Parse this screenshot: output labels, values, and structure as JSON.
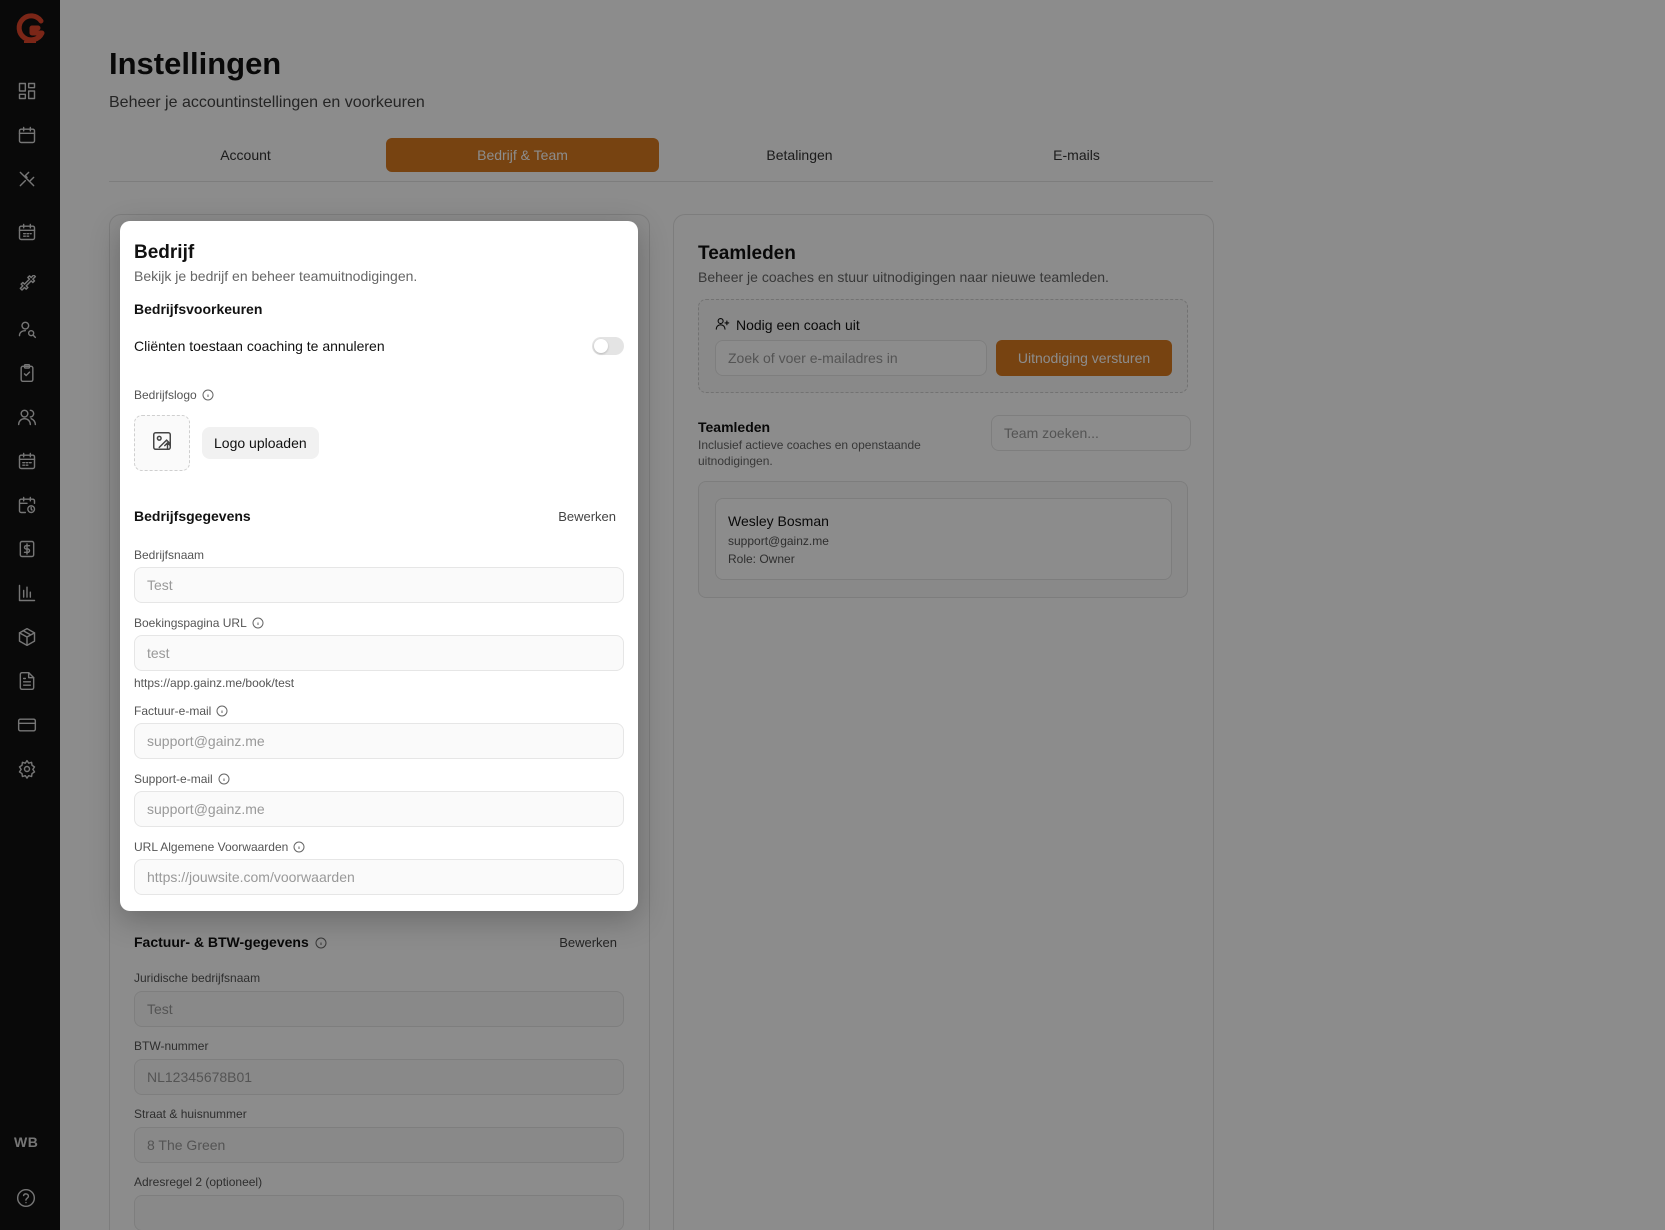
{
  "sidebar": {
    "avatar_initials": "WB",
    "icons": [
      "dashboard-icon",
      "calendar-icon",
      "tools-icon",
      "planner-icon",
      "dumbbell-icon",
      "client-search-icon",
      "clipboard-check-icon",
      "users-icon",
      "schedule-icon",
      "clock-calendar-icon",
      "dollar-icon",
      "bar-chart-icon",
      "package-icon",
      "document-icon",
      "credit-card-icon",
      "settings-icon",
      "help-icon"
    ]
  },
  "header": {
    "title": "Instellingen",
    "subtitle": "Beheer je accountinstellingen en voorkeuren"
  },
  "tabs": [
    {
      "label": "Account",
      "active": false
    },
    {
      "label": "Bedrijf & Team",
      "active": true
    },
    {
      "label": "Betalingen",
      "active": false
    },
    {
      "label": "E-mails",
      "active": false
    }
  ],
  "company": {
    "title": "Bedrijf",
    "subtitle": "Bekijk je bedrijf en beheer teamuitnodigingen.",
    "prefs_title": "Bedrijfsvoorkeuren",
    "cancel_toggle_label": "Cliënten toestaan coaching te annuleren",
    "cancel_toggle_on": false,
    "logo_label": "Bedrijfslogo",
    "logo_upload": "Logo uploaden",
    "details_title": "Bedrijfsgegevens",
    "details_edit": "Bewerken",
    "name_label": "Bedrijfsnaam",
    "name_value": "Test",
    "booking_label": "Boekingspagina URL",
    "booking_value": "test",
    "booking_hint": "https://app.gainz.me/book/test",
    "invoice_email_label": "Factuur-e-mail",
    "invoice_email_placeholder": "support@gainz.me",
    "support_email_label": "Support-e-mail",
    "support_email_placeholder": "support@gainz.me",
    "terms_label": "URL Algemene Voorwaarden",
    "terms_placeholder": "https://jouwsite.com/voorwaarden"
  },
  "billing": {
    "title": "Factuur- & BTW-gegevens",
    "edit": "Bewerken",
    "legal_name_label": "Juridische bedrijfsnaam",
    "legal_name_value": "Test",
    "vat_label": "BTW-nummer",
    "vat_placeholder": "NL12345678B01",
    "street_label": "Straat & huisnummer",
    "street_value": "8 The Green",
    "address2_label": "Adresregel 2 (optioneel)"
  },
  "team": {
    "title": "Teamleden",
    "subtitle": "Beheer je coaches en stuur uitnodigingen naar nieuwe teamleden.",
    "invite_title": "Nodig een coach uit",
    "invite_placeholder": "Zoek of voer e-mailadres in",
    "invite_button": "Uitnodiging versturen",
    "list_title": "Teamleden",
    "list_subtitle": "Inclusief actieve coaches en openstaande uitnodigingen.",
    "search_placeholder": "Team zoeken...",
    "members": [
      {
        "name": "Wesley Bosman",
        "email": "support@gainz.me",
        "role": "Role: Owner"
      }
    ]
  }
}
